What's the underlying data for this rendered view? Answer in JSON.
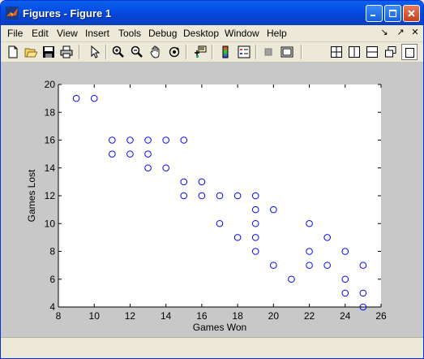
{
  "window": {
    "title": "Figures - Figure 1",
    "colors": {
      "title_bar": "#0a5fe8",
      "figure_bg": "#c8c8c8",
      "marker": "#0000ff"
    }
  },
  "menu": {
    "items": [
      "File",
      "Edit",
      "View",
      "Insert",
      "Tools",
      "Debug",
      "Desktop",
      "Window",
      "Help"
    ],
    "right_icons": [
      "undock-arrow-icon",
      "dock-arrow-icon",
      "close-x-icon"
    ]
  },
  "toolbar": {
    "buttons": [
      "new-figure-icon",
      "open-file-icon",
      "save-icon",
      "print-icon",
      "pointer-arrow-icon",
      "zoom-in-icon",
      "zoom-out-icon",
      "pan-hand-icon",
      "rotate-3d-icon",
      "insert-data-cursor-icon",
      "insert-colorbar-icon",
      "insert-legend-icon",
      "hide-plot-tools-icon",
      "show-plot-tools-icon",
      "tile-layout-icon",
      "left-right-layout-icon",
      "top-bottom-layout-icon",
      "float-window-icon",
      "maximize-figure-icon"
    ]
  },
  "chart_data": {
    "type": "scatter",
    "title": "",
    "xlabel": "Games Won",
    "ylabel": "Games Lost",
    "xlim": [
      8,
      26
    ],
    "ylim": [
      4,
      20
    ],
    "xticks": [
      8,
      10,
      12,
      14,
      16,
      18,
      20,
      22,
      24,
      26
    ],
    "yticks": [
      4,
      6,
      8,
      10,
      12,
      14,
      16,
      18,
      20
    ],
    "grid": false,
    "marker": "circle",
    "color": "#0000ff",
    "points": [
      [
        9,
        19
      ],
      [
        10,
        19
      ],
      [
        11,
        16
      ],
      [
        11,
        15
      ],
      [
        12,
        16
      ],
      [
        12,
        15
      ],
      [
        13,
        16
      ],
      [
        13,
        15
      ],
      [
        13,
        14
      ],
      [
        14,
        16
      ],
      [
        14,
        14
      ],
      [
        15,
        16
      ],
      [
        15,
        13
      ],
      [
        15,
        12
      ],
      [
        16,
        13
      ],
      [
        16,
        12
      ],
      [
        17,
        12
      ],
      [
        17,
        10
      ],
      [
        18,
        12
      ],
      [
        18,
        9
      ],
      [
        19,
        12
      ],
      [
        19,
        11
      ],
      [
        19,
        10
      ],
      [
        19,
        9
      ],
      [
        19,
        8
      ],
      [
        20,
        11
      ],
      [
        20,
        7
      ],
      [
        21,
        6
      ],
      [
        22,
        10
      ],
      [
        22,
        8
      ],
      [
        22,
        7
      ],
      [
        23,
        9
      ],
      [
        23,
        7
      ],
      [
        24,
        8
      ],
      [
        24,
        6
      ],
      [
        24,
        5
      ],
      [
        25,
        7
      ],
      [
        25,
        5
      ],
      [
        25,
        4
      ]
    ]
  }
}
